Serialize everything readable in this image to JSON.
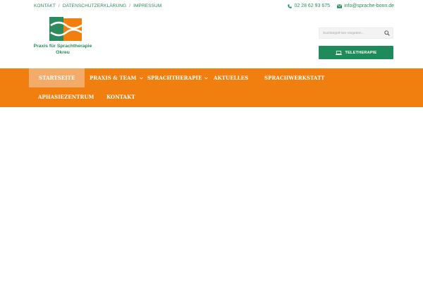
{
  "topbar": {
    "links": [
      "KONTAKT",
      "DATENSCHUTZERKLÄRUNG",
      "IMPRESSUM"
    ],
    "separator": "/",
    "phone": "02 28 62 93 675",
    "email": "info@sprache-bonn.de"
  },
  "logo": {
    "line1": "Praxis für Sprachtherapie",
    "line2": "Okreu",
    "colors": {
      "green": "#2b8a5e",
      "orange": "#f07f10"
    }
  },
  "search": {
    "placeholder": "Suchbegriff hier eingeben..."
  },
  "tele_button": {
    "label": "TELETHERAPIE",
    "icon": "laptop-icon"
  },
  "nav": {
    "items": [
      {
        "label": "STARTSEITE",
        "active": true,
        "has_submenu": false
      },
      {
        "label": "PRAXIS & TEAM",
        "active": false,
        "has_submenu": true
      },
      {
        "label": "SPRACHTHERAPIE",
        "active": false,
        "has_submenu": true
      },
      {
        "label": "AKTUELLES",
        "active": false,
        "has_submenu": false
      },
      {
        "label": "SPRACHWERKSTATT",
        "active": false,
        "has_submenu": false
      },
      {
        "label": "APHASIEZENTRUM",
        "active": false,
        "has_submenu": false
      },
      {
        "label": "KONTAKT",
        "active": false,
        "has_submenu": false
      }
    ]
  },
  "colors": {
    "accent": "#f07f10",
    "brand_green": "#1f8a5a",
    "active_tab": "#f3ab6a"
  }
}
